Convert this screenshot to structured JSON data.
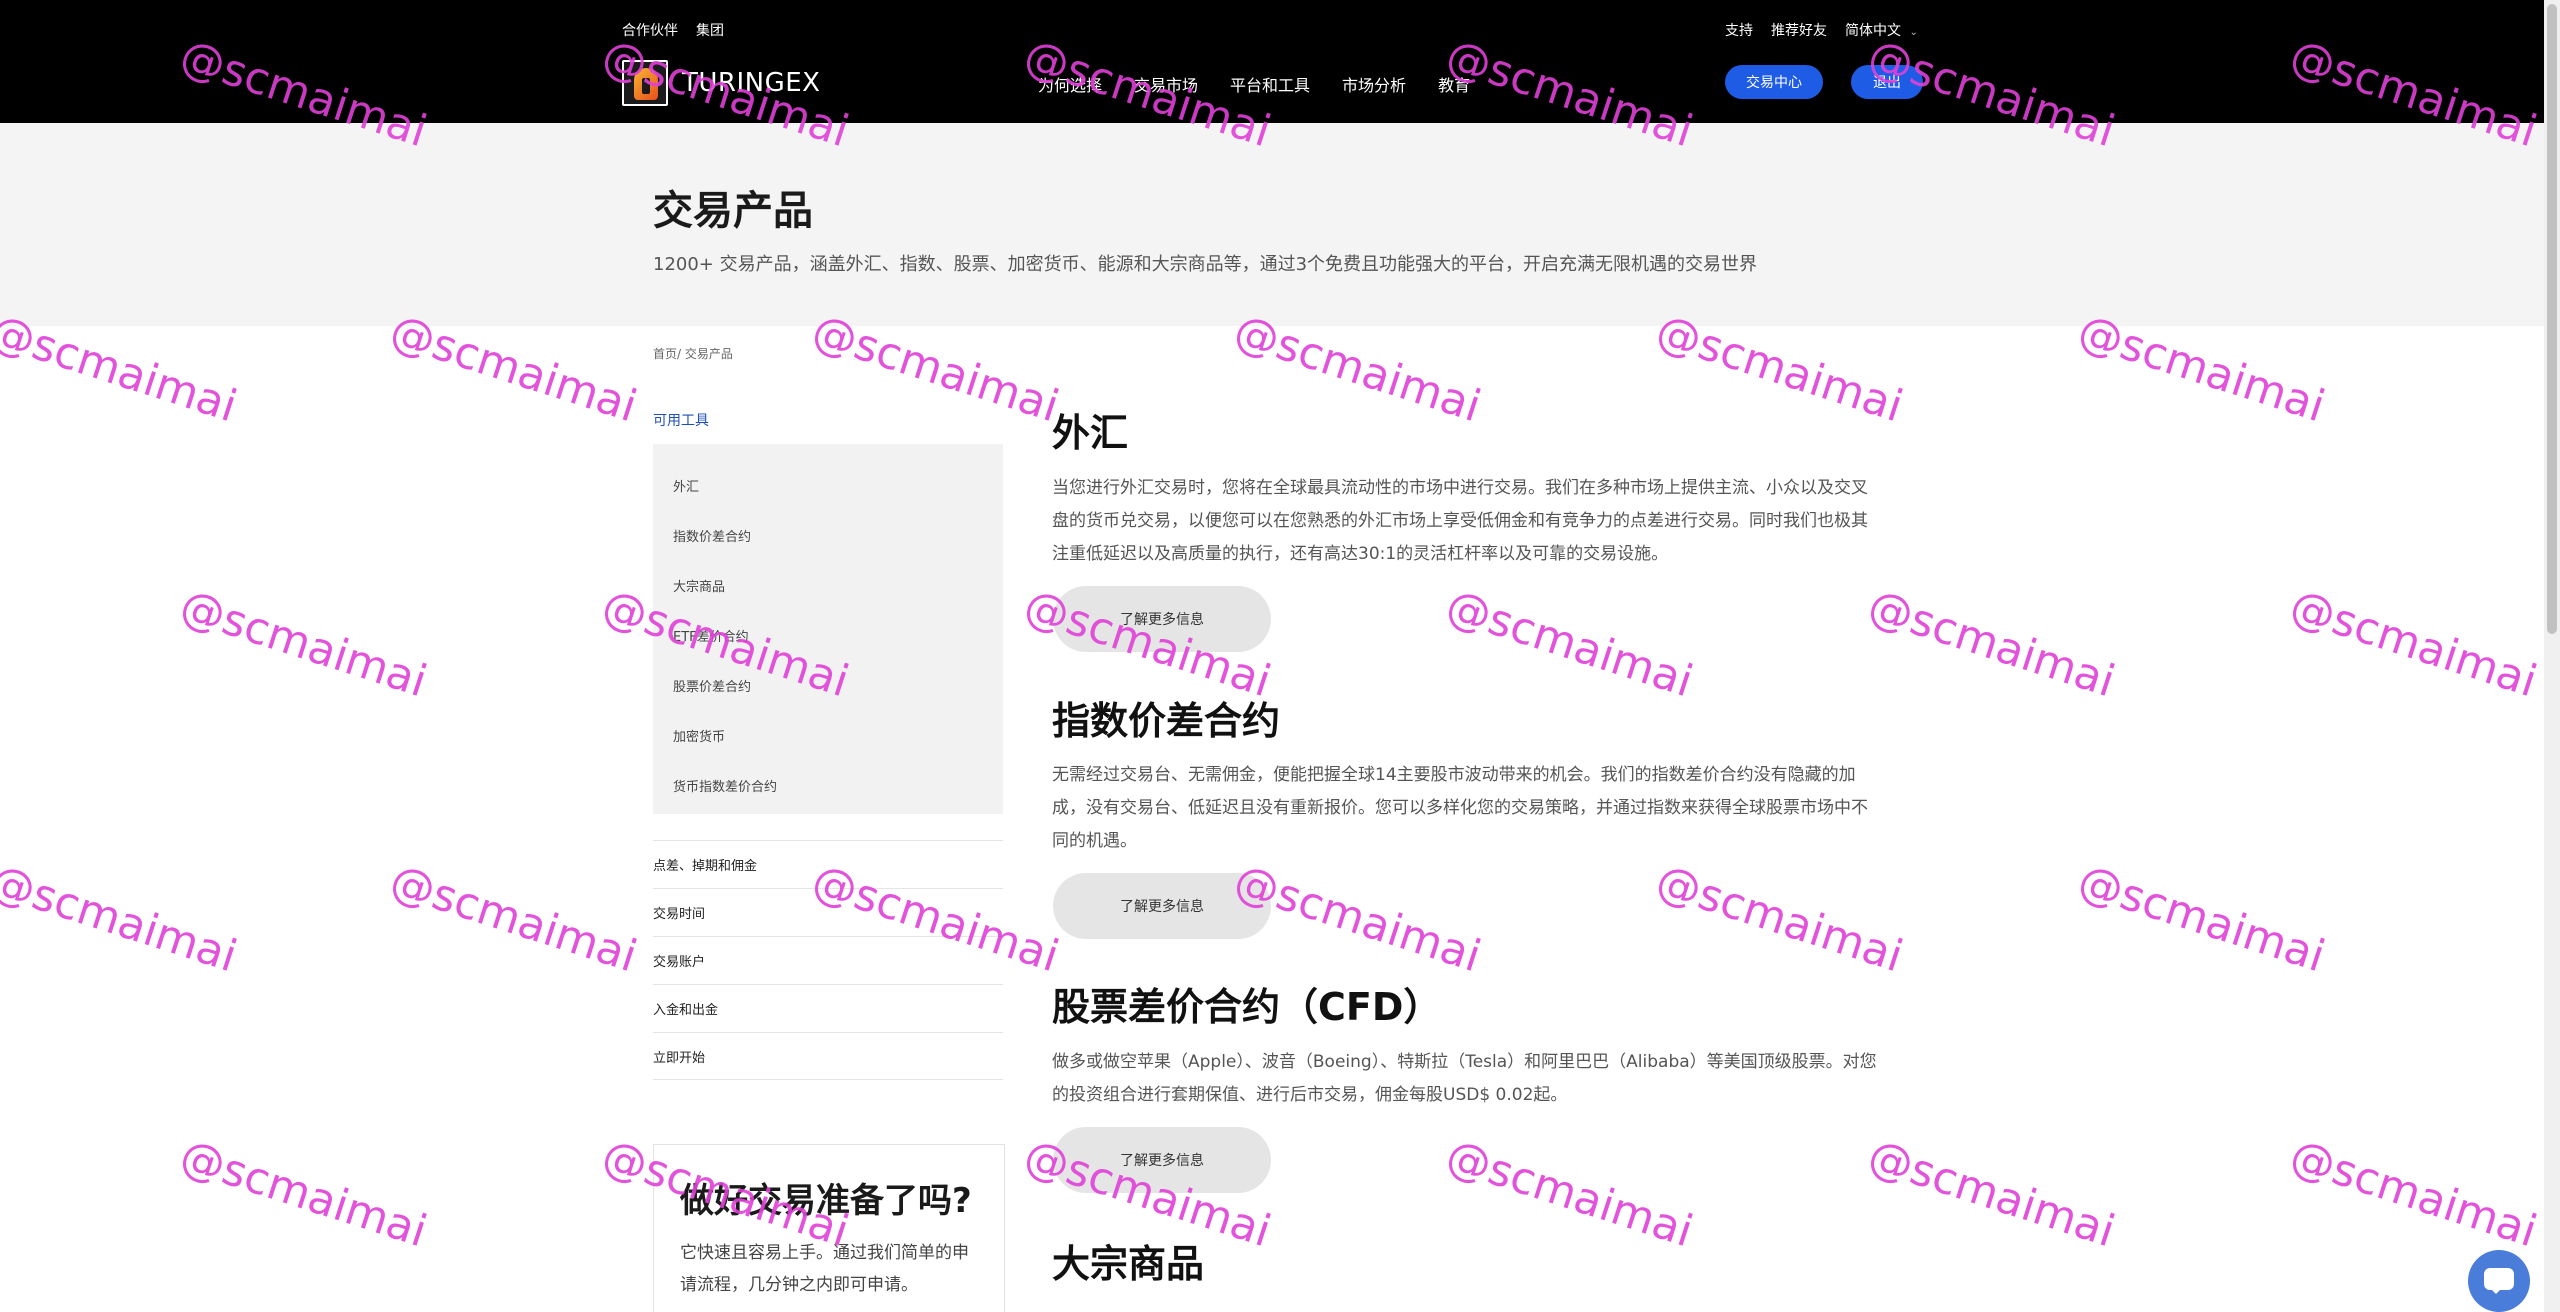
{
  "topbar": {
    "left": [
      "合作伙伴",
      "集团"
    ],
    "right": [
      "支持",
      "推荐好友"
    ],
    "language": "简体中文"
  },
  "logo": {
    "text": "TURINGEX"
  },
  "nav": [
    "为何选择",
    "交易市场",
    "平台和工具",
    "市场分析",
    "教育"
  ],
  "buttons": {
    "trading_center": "交易中心",
    "logout": "退出"
  },
  "hero": {
    "title": "交易产品",
    "subtitle": "1200+ 交易产品，涵盖外汇、指数、股票、加密货币、能源和大宗商品等，通过3个免费且功能强大的平台，开启充满无限机遇的交易世界"
  },
  "breadcrumb": "首页/ 交易产品",
  "sidebar": {
    "label": "可用工具",
    "items": [
      "外汇",
      "指数价差合约",
      "大宗商品",
      "ETF差价合约",
      "股票价差合约",
      "加密货币",
      "货币指数差价合约"
    ],
    "links": [
      "点差、掉期和佣金",
      "交易时间",
      "交易账户",
      "入金和出金",
      "立即开始"
    ]
  },
  "ready_card": {
    "title": "做好交易准备了吗?",
    "text": "它快速且容易上手。通过我们简单的申请流程，几分钟之内即可申请。"
  },
  "sections": [
    {
      "title": "外汇",
      "text": "当您进行外汇交易时，您将在全球最具流动性的市场中进行交易。我们在多种市场上提供主流、小众以及交叉盘的货币兑交易，以便您可以在您熟悉的外汇市场上享受低佣金和有竞争力的点差进行交易。同时我们也极其注重低延迟以及高质量的执行，还有高达30:1的灵活杠杆率以及可靠的交易设施。",
      "button": "了解更多信息"
    },
    {
      "title": "指数价差合约",
      "text": "无需经过交易台、无需佣金，便能把握全球14主要股市波动带来的机会。我们的指数差价合约没有隐藏的加成，没有交易台、低延迟且没有重新报价。您可以多样化您的交易策略，并通过指数来获得全球股票市场中不同的机遇。",
      "button": "了解更多信息"
    },
    {
      "title": "股票差价合约（CFD）",
      "text": "做多或做空苹果（Apple）、波音（Boeing）、特斯拉（Tesla）和阿里巴巴（Alibaba）等美国顶级股票。对您的投资组合进行套期保值、进行后市交易，佣金每股USD$ 0.02起。",
      "button": "了解更多信息"
    },
    {
      "title": "大宗商品"
    }
  ],
  "watermark": "@scmaimai",
  "colors": {
    "accent": "#1f5ce6",
    "header_bg": "#000000",
    "watermark": "#e040d8"
  }
}
